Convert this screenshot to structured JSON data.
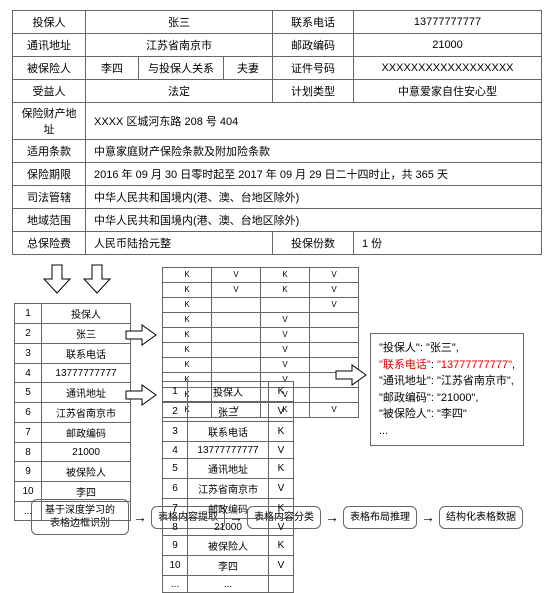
{
  "policy": {
    "r1": {
      "l1": "投保人",
      "v1": "张三",
      "l2": "联系电话",
      "v2": "13777777777"
    },
    "r2": {
      "l1": "通讯地址",
      "v1": "江苏省南京市",
      "l2": "邮政编码",
      "v2": "21000"
    },
    "r3": {
      "l1": "被保险人",
      "v1": "李四",
      "l2": "与投保人关系",
      "v2": "夫妻",
      "l3": "证件号码",
      "v3": "XXXXXXXXXXXXXXXXXX"
    },
    "r4": {
      "l1": "受益人",
      "v1": "法定",
      "l2": "计划类型",
      "v2": "中意爱家自住安心型"
    },
    "r5": {
      "l1": "保险财产地址",
      "v1": "XXXX 区城河东路 208 号 404"
    },
    "r6": {
      "l1": "适用条款",
      "v1": "中意家庭财产保险条款及附加险条款"
    },
    "r7": {
      "l1": "保险期限",
      "v1": "2016 年 09 月 30 日零时起至 2017 年 09 月 29 日二十四时止，共 365 天"
    },
    "r8": {
      "l1": "司法管辖",
      "v1": "中华人民共和国境内(港、澳、台地区除外)"
    },
    "r9": {
      "l1": "地域范围",
      "v1": "中华人民共和国境内(港、澳、台地区除外)"
    },
    "r10": {
      "l1": "总保险费",
      "v1": "人民币陆拾元整",
      "l2": "投保份数",
      "v2": "1 份"
    }
  },
  "nlist": [
    {
      "n": "1",
      "t": "投保人"
    },
    {
      "n": "2",
      "t": "张三"
    },
    {
      "n": "3",
      "t": "联系电话"
    },
    {
      "n": "4",
      "t": "13777777777"
    },
    {
      "n": "5",
      "t": "通讯地址"
    },
    {
      "n": "6",
      "t": "江苏省南京市"
    },
    {
      "n": "7",
      "t": "邮政编码"
    },
    {
      "n": "8",
      "t": "21000"
    },
    {
      "n": "9",
      "t": "被保险人"
    },
    {
      "n": "10",
      "t": "李四"
    },
    {
      "n": "...",
      "t": "..."
    }
  ],
  "pat": [
    [
      "K",
      "V",
      "K",
      "V"
    ],
    [
      "K",
      "V",
      "K",
      "V"
    ],
    [
      "K",
      "",
      "",
      "V"
    ],
    [
      "K",
      "",
      "V",
      ""
    ],
    [
      "K",
      "",
      "V",
      ""
    ],
    [
      "K",
      "",
      "V",
      ""
    ],
    [
      "K",
      "",
      "V",
      ""
    ],
    [
      "K",
      "",
      "V",
      ""
    ],
    [
      "K",
      "",
      "V",
      ""
    ],
    [
      "K",
      "V",
      "K",
      "V"
    ]
  ],
  "kvt": [
    {
      "n": "1",
      "t": "投保人",
      "k": "K"
    },
    {
      "n": "2",
      "t": "张三",
      "k": "V"
    },
    {
      "n": "3",
      "t": "联系电话",
      "k": "K"
    },
    {
      "n": "4",
      "t": "13777777777",
      "k": "V"
    },
    {
      "n": "5",
      "t": "通讯地址",
      "k": "K"
    },
    {
      "n": "6",
      "t": "江苏省南京市",
      "k": "V"
    },
    {
      "n": "7",
      "t": "邮政编码",
      "k": "K"
    },
    {
      "n": "8",
      "t": "21000",
      "k": "V"
    },
    {
      "n": "9",
      "t": "被保险人",
      "k": "K"
    },
    {
      "n": "10",
      "t": "李四",
      "k": "V"
    },
    {
      "n": "...",
      "t": "...",
      "k": ""
    }
  ],
  "json": {
    "l1a": "\"投保人\"",
    "l1b": "\"张三\"",
    "l2a": "\"联系电话\"",
    "l2b": "\"13777777777\"",
    "l3a": "\"通讯地址\"",
    "l3b": "\"江苏省南京市\"",
    "l4a": "\"邮政编码\"",
    "l4b": "\"21000\"",
    "l5a": "\"被保险人\"",
    "l5b": "\"李四\"",
    "ellipsis": "..."
  },
  "pipeline": {
    "s1": "基于深度学习的\n表格边框识别",
    "s2": "表格内容提取",
    "s3": "表格内容分类",
    "s4": "表格布局推理",
    "s5": "结构化表格数据"
  }
}
